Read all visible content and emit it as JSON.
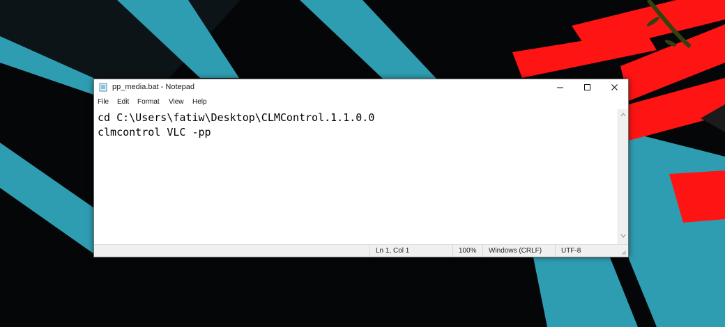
{
  "window": {
    "title": "pp_media.bat - Notepad"
  },
  "menu": {
    "items": [
      "File",
      "Edit",
      "Format",
      "View",
      "Help"
    ]
  },
  "editor": {
    "lines": [
      "cd C:\\Users\\fatiw\\Desktop\\CLMControl.1.1.0.0",
      "clmcontrol VLC -pp"
    ]
  },
  "status": {
    "position": "Ln 1, Col 1",
    "zoom": "100%",
    "line_endings": "Windows (CRLF)",
    "encoding": "UTF-8"
  },
  "icons": {
    "app": "notepad-icon",
    "minimize": "minimize-icon",
    "maximize": "maximize-icon",
    "close": "close-icon",
    "scroll_up": "scroll-up-icon",
    "scroll_down": "scroll-down-icon",
    "grip": "resize-grip-icon"
  },
  "colors": {
    "desktop_background": "#050607",
    "teal_shape": "#2f9db1",
    "red_shape": "#ff1414",
    "window_border": "#6f6f6f",
    "statusbar": "#f0f0f0",
    "text": "#000000"
  }
}
